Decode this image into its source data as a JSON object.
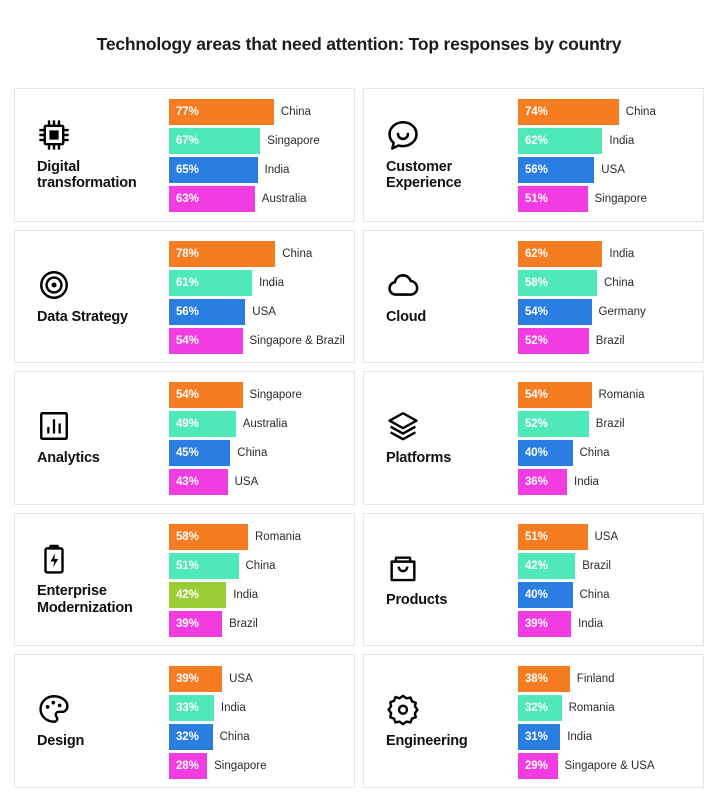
{
  "header": {
    "title": "Technology areas that need attention: Top responses by country"
  },
  "palette": {
    "orange": "#F57C20",
    "mint": "#4FE8B8",
    "blue": "#2A7DE1",
    "magenta": "#F03CE0",
    "lime": "#9ACD32",
    "card_border": "#e6e6e6",
    "card_background": "#ffffff",
    "title_color": "#1c1c1c",
    "label_color": "#2b2b2b",
    "value_color": "#ffffff"
  },
  "chart_data": {
    "type": "bar",
    "title": "Technology areas that need attention: Top responses by country",
    "xlabel": "",
    "ylabel": "",
    "orientation": "horizontal",
    "value_unit": "%",
    "xlim": [
      0,
      80
    ],
    "grid": false,
    "legend": "none",
    "panel_layout": {
      "columns": 2,
      "rows": 5
    },
    "panels": [
      {
        "name": "Digital transformation",
        "icon": "microchip-icon",
        "categories": [
          "China",
          "Singapore",
          "India",
          "Australia"
        ],
        "values": [
          77,
          67,
          65,
          63
        ],
        "value_labels": [
          "77%",
          "67%",
          "65%",
          "63%"
        ],
        "colors": [
          "#F57C20",
          "#4FE8B8",
          "#2A7DE1",
          "#F03CE0"
        ]
      },
      {
        "name": "Customer Experience",
        "icon": "chat-smile-icon",
        "categories": [
          "China",
          "India",
          "USA",
          "Singapore"
        ],
        "values": [
          74,
          62,
          56,
          51
        ],
        "value_labels": [
          "74%",
          "62%",
          "56%",
          "51%"
        ],
        "colors": [
          "#F57C20",
          "#4FE8B8",
          "#2A7DE1",
          "#F03CE0"
        ]
      },
      {
        "name": "Data Strategy",
        "icon": "target-icon",
        "categories": [
          "China",
          "India",
          "USA",
          "Singapore & Brazil"
        ],
        "values": [
          78,
          61,
          56,
          54
        ],
        "value_labels": [
          "78%",
          "61%",
          "56%",
          "54%"
        ],
        "colors": [
          "#F57C20",
          "#4FE8B8",
          "#2A7DE1",
          "#F03CE0"
        ]
      },
      {
        "name": "Cloud",
        "icon": "cloud-icon",
        "categories": [
          "India",
          "China",
          "Germany",
          "Brazil"
        ],
        "values": [
          62,
          58,
          54,
          52
        ],
        "value_labels": [
          "62%",
          "58%",
          "54%",
          "52%"
        ],
        "colors": [
          "#F57C20",
          "#4FE8B8",
          "#2A7DE1",
          "#F03CE0"
        ]
      },
      {
        "name": "Analytics",
        "icon": "bar-chart-icon",
        "categories": [
          "Singapore",
          "Australia",
          "China",
          "USA"
        ],
        "values": [
          54,
          49,
          45,
          43
        ],
        "value_labels": [
          "54%",
          "49%",
          "45%",
          "43%"
        ],
        "colors": [
          "#F57C20",
          "#4FE8B8",
          "#2A7DE1",
          "#F03CE0"
        ]
      },
      {
        "name": "Platforms",
        "icon": "layers-icon",
        "categories": [
          "Romania",
          "Brazil",
          "China",
          "India"
        ],
        "values": [
          54,
          52,
          40,
          36
        ],
        "value_labels": [
          "54%",
          "52%",
          "40%",
          "36%"
        ],
        "colors": [
          "#F57C20",
          "#4FE8B8",
          "#2A7DE1",
          "#F03CE0"
        ]
      },
      {
        "name": "Enterprise Modernization",
        "icon": "battery-bolt-icon",
        "categories": [
          "Romania",
          "China",
          "India",
          "Brazil"
        ],
        "values": [
          58,
          51,
          42,
          39
        ],
        "value_labels": [
          "58%",
          "51%",
          "42%",
          "39%"
        ],
        "colors": [
          "#F57C20",
          "#4FE8B8",
          "#9ACD32",
          "#F03CE0"
        ]
      },
      {
        "name": "Products",
        "icon": "shopping-bag-icon",
        "categories": [
          "USA",
          "Brazil",
          "China",
          "India"
        ],
        "values": [
          51,
          42,
          40,
          39
        ],
        "value_labels": [
          "51%",
          "42%",
          "40%",
          "39%"
        ],
        "colors": [
          "#F57C20",
          "#4FE8B8",
          "#2A7DE1",
          "#F03CE0"
        ]
      },
      {
        "name": "Design",
        "icon": "palette-icon",
        "categories": [
          "USA",
          "India",
          "China",
          "Singapore"
        ],
        "values": [
          39,
          33,
          32,
          28
        ],
        "value_labels": [
          "39%",
          "33%",
          "32%",
          "28%"
        ],
        "colors": [
          "#F57C20",
          "#4FE8B8",
          "#2A7DE1",
          "#F03CE0"
        ]
      },
      {
        "name": "Engineering",
        "icon": "gear-icon",
        "categories": [
          "Finland",
          "Romania",
          "India",
          "Singapore & USA"
        ],
        "values": [
          38,
          32,
          31,
          29
        ],
        "value_labels": [
          "38%",
          "32%",
          "31%",
          "29%"
        ],
        "colors": [
          "#F57C20",
          "#4FE8B8",
          "#2A7DE1",
          "#F03CE0"
        ]
      }
    ]
  }
}
